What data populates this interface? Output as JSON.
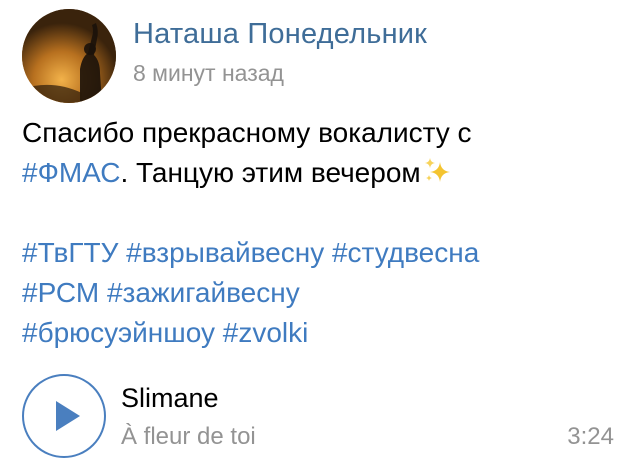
{
  "post": {
    "author_name": "Наташа Понедельник",
    "time": "8 минут назад",
    "text": {
      "line1": "Спасибо прекрасному вокалисту с",
      "line2_tag": "#ФМАС",
      "line2_text": ". Танцую этим вечером",
      "line2_emoji": "sparkles-emoji",
      "tags_line1": [
        "#ТвГТУ",
        "#взрывайвесну",
        "#студвесна"
      ],
      "tags_line2": [
        "#РСМ",
        "#зажигайвесну"
      ],
      "tags_line3": [
        "#брюсуэйншоу",
        "#zvolki"
      ]
    },
    "audio": {
      "title": "Slimane",
      "artist": "À fleur de toi",
      "duration": "3:24",
      "play_icon": "play-icon"
    }
  },
  "colors": {
    "link": "#3f7bc0",
    "author": "#3f6d98",
    "meta": "#939393",
    "text": "#000000",
    "play_border": "#4a7fbf"
  }
}
